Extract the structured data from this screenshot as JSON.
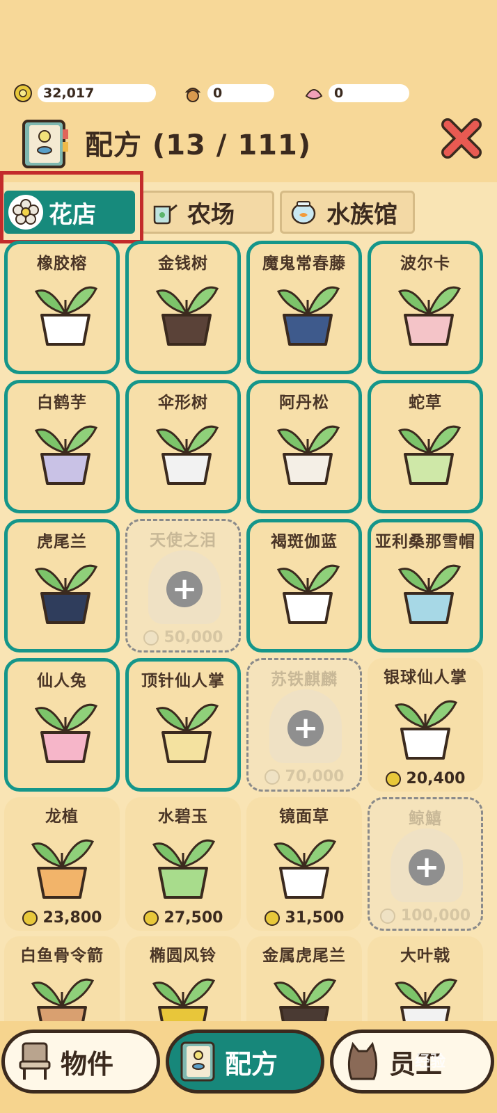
{
  "currencies": [
    {
      "icon": "flower-coin-icon",
      "value": "32,017"
    },
    {
      "icon": "acorn-icon",
      "value": "0"
    },
    {
      "icon": "pink-shell-icon",
      "value": "0"
    }
  ],
  "header": {
    "title": "配方 (13 / 111)"
  },
  "tabs": [
    {
      "label": "花店",
      "icon": "flower-tab-icon",
      "active": true
    },
    {
      "label": "农场",
      "icon": "watering-can-icon",
      "active": false
    },
    {
      "label": "水族馆",
      "icon": "fish-bowl-icon",
      "active": false
    }
  ],
  "recipes": [
    {
      "name": "橡胶榕",
      "state": "owned",
      "price": ""
    },
    {
      "name": "金钱树",
      "state": "owned",
      "price": ""
    },
    {
      "name": "魔鬼常春藤",
      "state": "owned",
      "price": ""
    },
    {
      "name": "波尔卡",
      "state": "owned",
      "price": ""
    },
    {
      "name": "白鹤芋",
      "state": "owned",
      "price": ""
    },
    {
      "name": "伞形树",
      "state": "owned",
      "price": ""
    },
    {
      "name": "阿丹松",
      "state": "owned",
      "price": ""
    },
    {
      "name": "蛇草",
      "state": "owned",
      "price": ""
    },
    {
      "name": "虎尾兰",
      "state": "owned",
      "price": ""
    },
    {
      "name": "天使之泪",
      "state": "locked",
      "price": "50,000"
    },
    {
      "name": "褐斑伽蓝",
      "state": "owned",
      "price": ""
    },
    {
      "name": "亚利桑那雪帽",
      "state": "owned",
      "price": ""
    },
    {
      "name": "仙人兔",
      "state": "owned",
      "price": ""
    },
    {
      "name": "顶针仙人掌",
      "state": "owned",
      "price": ""
    },
    {
      "name": "苏铁麒麟",
      "state": "locked",
      "price": "70,000"
    },
    {
      "name": "银球仙人掌",
      "state": "buy",
      "price": "20,400"
    },
    {
      "name": "龙植",
      "state": "buy",
      "price": "23,800"
    },
    {
      "name": "水碧玉",
      "state": "buy",
      "price": "27,500"
    },
    {
      "name": "镜面草",
      "state": "buy",
      "price": "31,500"
    },
    {
      "name": "鲸鱚",
      "state": "locked",
      "price": "100,000"
    },
    {
      "name": "白鱼骨令箭",
      "state": "buy",
      "price": ""
    },
    {
      "name": "椭圆风铃",
      "state": "buy",
      "price": ""
    },
    {
      "name": "金属虎尾兰",
      "state": "buy",
      "price": ""
    },
    {
      "name": "大叶戟",
      "state": "buy",
      "price": ""
    }
  ],
  "bottom_nav": [
    {
      "label": "物件",
      "icon": "chair-icon",
      "active": false
    },
    {
      "label": "配方",
      "icon": "recipe-book-icon",
      "active": true
    },
    {
      "label": "员工",
      "icon": "cat-staff-icon",
      "active": false
    }
  ],
  "watermark": "经验"
}
